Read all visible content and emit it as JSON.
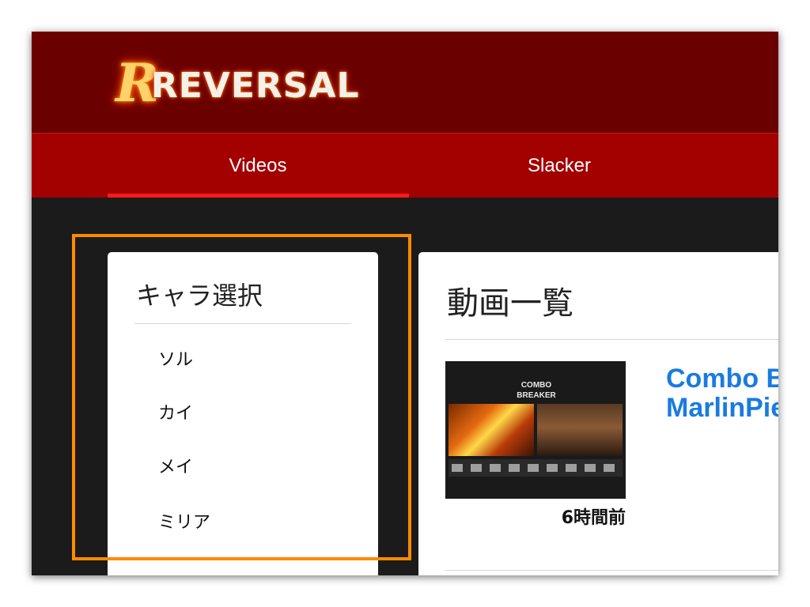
{
  "header": {
    "logo_initial": "R",
    "logo_text": "REVERSAL"
  },
  "nav": {
    "tabs": [
      {
        "label": "Videos",
        "active": true
      },
      {
        "label": "Slacker",
        "active": false
      }
    ]
  },
  "sidebar": {
    "title": "キャラ選択",
    "items": [
      "ソル",
      "カイ",
      "メイ",
      "ミリア"
    ]
  },
  "main": {
    "title": "動画一覧",
    "videos": [
      {
        "title_line1": "Combo B",
        "title_line2": "MarlinPie",
        "time": "6時間前",
        "thumbnail_logo": "COMBO BREAKER"
      }
    ]
  },
  "colors": {
    "header_bg": "#6b0000",
    "nav_bg": "#a30000",
    "nav_active_underline": "#ff1a1a",
    "page_bg": "#1b1b1b",
    "link": "#1a7be0",
    "highlight": "#ff8a00"
  }
}
